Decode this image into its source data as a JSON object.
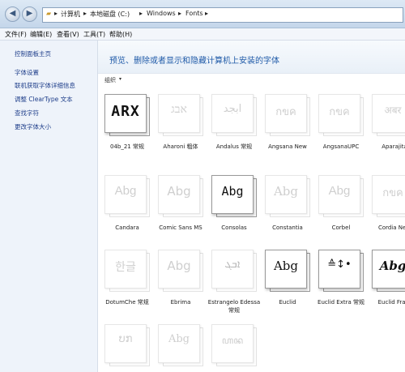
{
  "address_bar": {
    "segments": [
      "计算机",
      "本地磁盘 (C:)",
      "Windows",
      "Fonts"
    ],
    "separator": "▸"
  },
  "menu": [
    "文件(F)",
    "编辑(E)",
    "查看(V)",
    "工具(T)",
    "帮助(H)"
  ],
  "sidebar": {
    "items": [
      "控制面板主页",
      "字体设置",
      "联机获取字体详细信息",
      "调整 ClearType 文本",
      "查找字符",
      "更改字体大小"
    ]
  },
  "header": {
    "title": "预览、删除或者显示和隐藏计算机上安装的字体"
  },
  "toolbar": {
    "organize": "组织",
    "organize_arrow": "▾"
  },
  "fonts": [
    {
      "label": "04b_21 常规",
      "sample": "ARX",
      "style": "strong"
    },
    {
      "label": "Aharoni 粗体",
      "sample": "אבג",
      "style": "faint"
    },
    {
      "label": "Andalus 常规",
      "sample": "ابجد",
      "style": "faint"
    },
    {
      "label": "Angsana New",
      "sample": "กขค",
      "style": "faint"
    },
    {
      "label": "AngsanaUPC",
      "sample": "กขค",
      "style": "faint"
    },
    {
      "label": "Aparajita",
      "sample": "अबर",
      "style": "faint"
    },
    {
      "label": "Candara",
      "sample": "Abg",
      "style": "faint"
    },
    {
      "label": "Comic Sans MS",
      "sample": "Abg",
      "style": "faint"
    },
    {
      "label": "Consolas",
      "sample": "Abg",
      "style": "strong"
    },
    {
      "label": "Constantia",
      "sample": "Abg",
      "style": "faint"
    },
    {
      "label": "Corbel",
      "sample": "Abg",
      "style": "faint"
    },
    {
      "label": "Cordia New",
      "sample": "กขค",
      "style": "faint"
    },
    {
      "label": "DotumChe 常规",
      "sample": "한글",
      "style": "faint"
    },
    {
      "label": "Ebrima",
      "sample": "Abg",
      "style": "faint"
    },
    {
      "label": "Estrangelo Edessa 常规",
      "sample": "ܐܒܓ",
      "style": "faint"
    },
    {
      "label": "Euclid",
      "sample": "Abg",
      "style": "strong"
    },
    {
      "label": "Euclid Extra 常规",
      "sample": "≙↕•",
      "style": "strong"
    },
    {
      "label": "Euclid Frakt",
      "sample": "Abg",
      "style": "strong"
    },
    {
      "label": "",
      "sample": "ບກ",
      "style": "faint"
    },
    {
      "label": "",
      "sample": "Abg",
      "style": "faint"
    },
    {
      "label": "",
      "sample": "ꦲꦤ",
      "style": "faint"
    }
  ]
}
